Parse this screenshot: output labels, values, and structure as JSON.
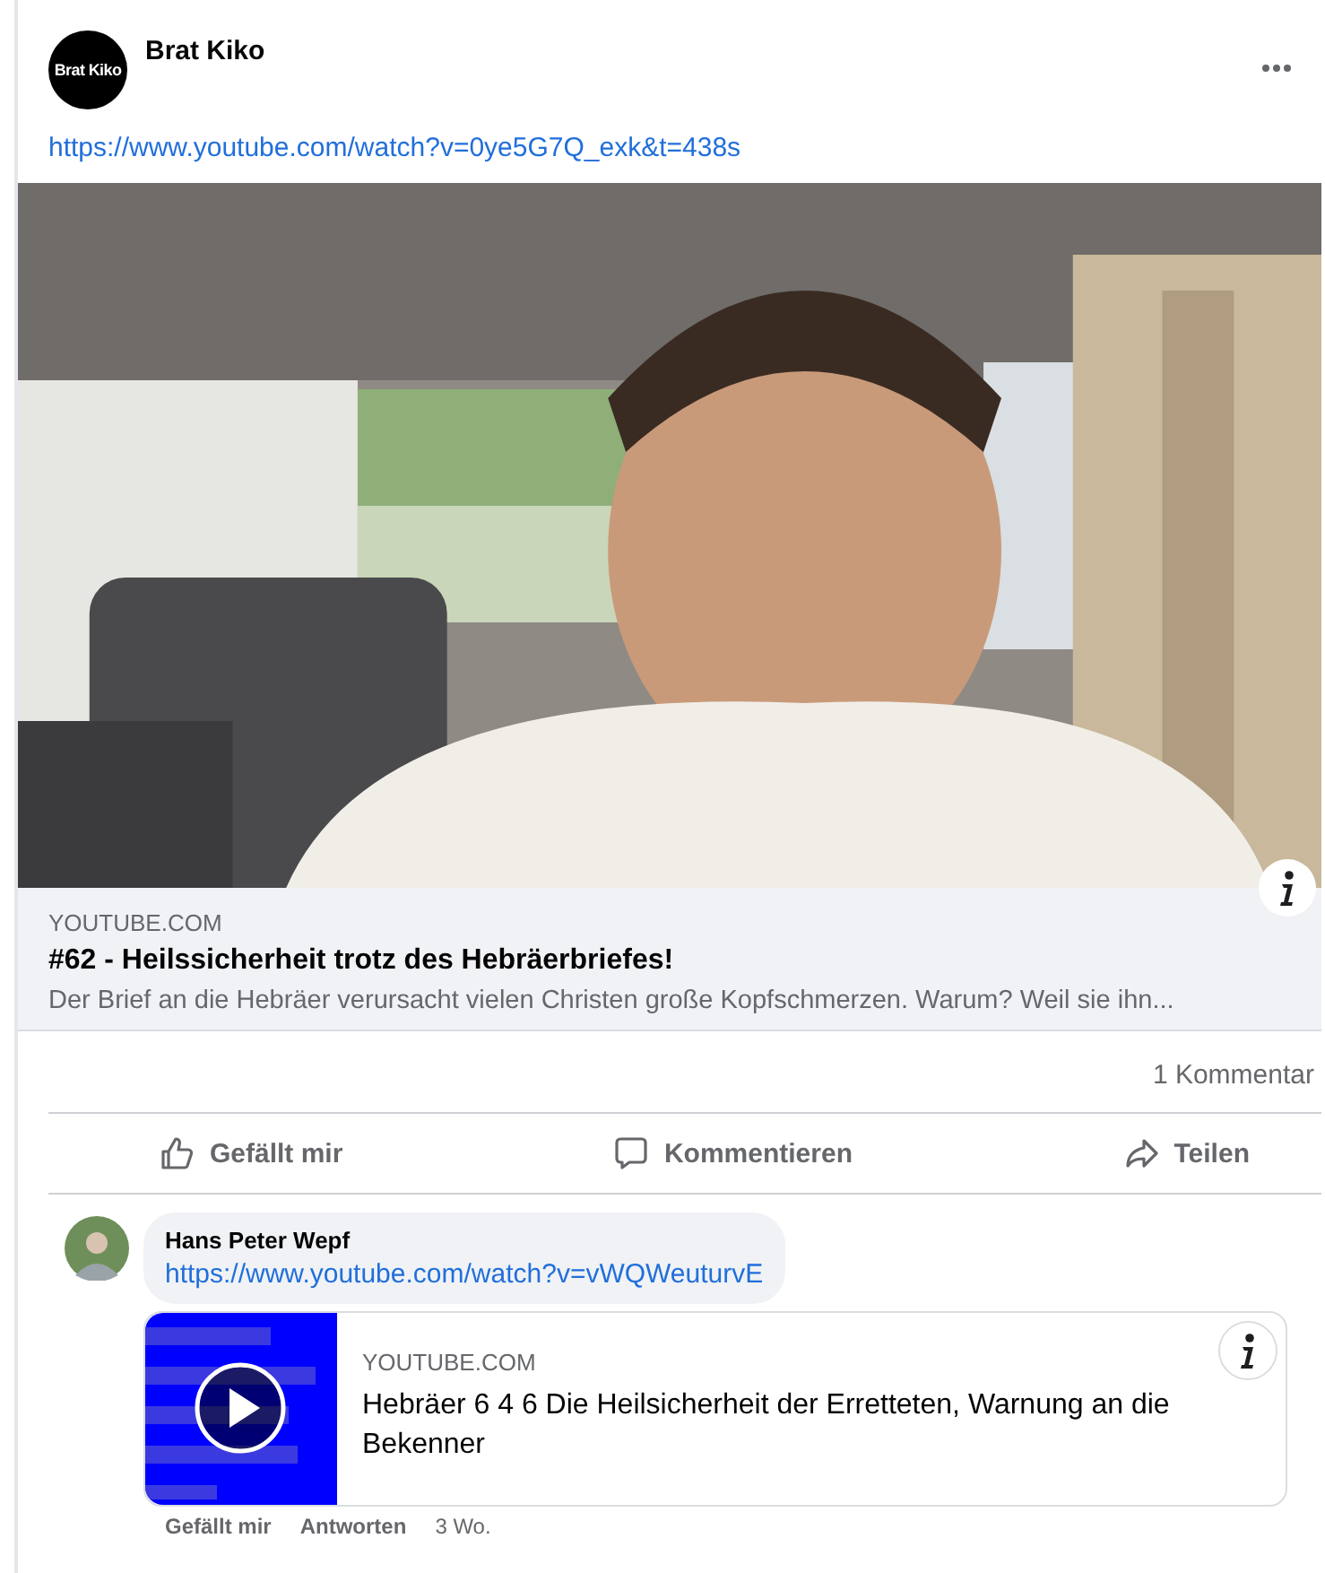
{
  "post": {
    "author": "Brat Kiko",
    "avatar_text": "Brat Kiko",
    "link": "https://www.youtube.com/watch?v=0ye5G7Q_exk&t=438s",
    "preview": {
      "kind": "picture",
      "domain": "YOUTUBE.COM",
      "title": "#62 - Heilssicherheit trotz des Hebräerbriefes!",
      "description": "Der Brief an die Hebräer verursacht vielen Christen große Kopfschmerzen. Warum? Weil sie ihn..."
    },
    "comment_count": "1 Kommentar",
    "actions": [
      {
        "kind": "like",
        "label": "Gefällt mir"
      },
      {
        "kind": "comment",
        "label": "Kommentieren"
      },
      {
        "kind": "share",
        "label": "Teilen"
      }
    ]
  },
  "comments": [
    {
      "author": "Hans Peter Wepf",
      "link": "https://www.youtube.com/watch?v=vWQWeuturvE",
      "preview": {
        "kind": "picture",
        "domain": "YOUTUBE.COM",
        "title": "Hebräer 6 4 6 Die Heilsicherheit der Erretteten, Warnung an die Bekenner"
      },
      "actions": [
        {
          "label": "Gefällt mir"
        },
        {
          "label": "Antworten"
        }
      ],
      "time": "3 Wo."
    }
  ]
}
